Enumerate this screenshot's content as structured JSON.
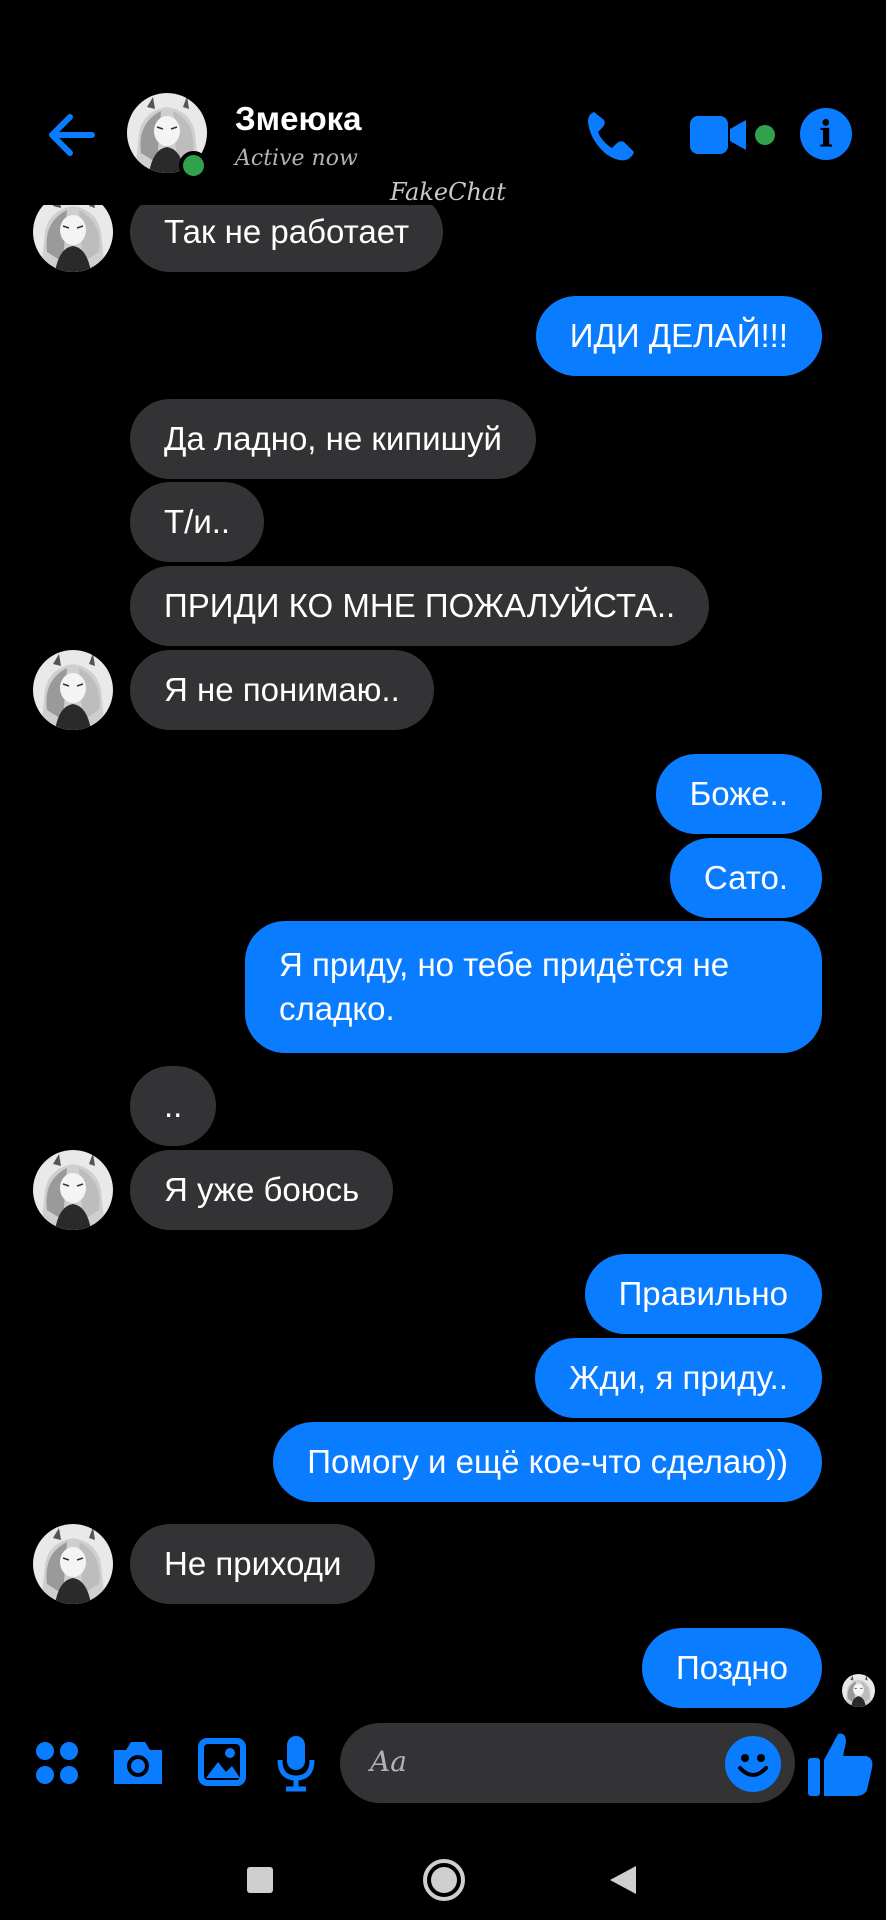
{
  "header": {
    "contact_name": "Змеюка",
    "status": "Active now",
    "watermark": "FakeChat"
  },
  "messages": [
    {
      "dir": "in",
      "text": "Так не работает"
    },
    {
      "dir": "out",
      "text": "ИДИ ДЕЛАЙ!!!"
    },
    {
      "dir": "in",
      "text": "Да ладно, не кипишуй"
    },
    {
      "dir": "in",
      "text": "Т/и.."
    },
    {
      "dir": "in",
      "text": "ПРИДИ КО МНЕ ПОЖАЛУЙСТА.."
    },
    {
      "dir": "in",
      "text": "Я не понимаю.."
    },
    {
      "dir": "out",
      "text": "Боже.."
    },
    {
      "dir": "out",
      "text": "Сато."
    },
    {
      "dir": "out",
      "text": "Я приду, но тебе придётся не сладко."
    },
    {
      "dir": "in",
      "text": ".."
    },
    {
      "dir": "in",
      "text": "Я уже боюсь"
    },
    {
      "dir": "out",
      "text": "Правильно"
    },
    {
      "dir": "out",
      "text": "Жди, я приду.."
    },
    {
      "dir": "out",
      "text": "Помогу и ещё кое-что сделаю))"
    },
    {
      "dir": "in",
      "text": "Не приходи"
    },
    {
      "dir": "out",
      "text": "Поздно"
    }
  ],
  "composer": {
    "placeholder": "Aa"
  },
  "colors": {
    "accent": "#0a7cff",
    "incoming_bubble": "#333335",
    "online": "#31a24c",
    "background": "#000000"
  },
  "icons": [
    "back-arrow-icon",
    "phone-icon",
    "video-camera-icon",
    "info-icon",
    "apps-icon",
    "camera-icon",
    "gallery-icon",
    "microphone-icon",
    "emoji-icon",
    "thumbs-up-icon",
    "recent-apps-icon",
    "home-icon",
    "back-nav-icon"
  ]
}
